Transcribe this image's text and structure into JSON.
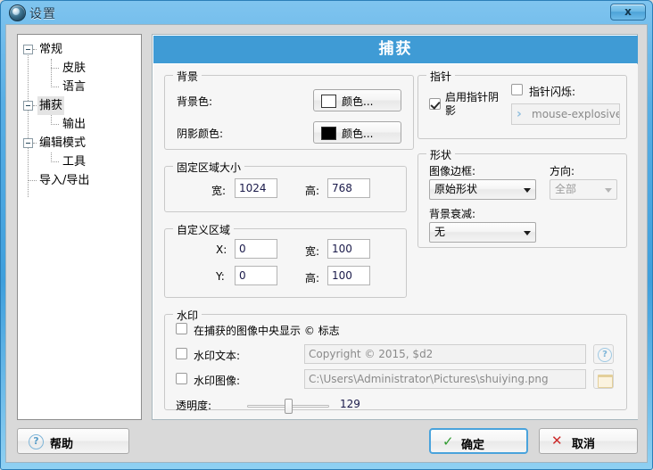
{
  "window": {
    "title": "设置",
    "icon": "app-camera-icon",
    "close_label": "x",
    "accent_color": "#3f9bd5",
    "frame_color": "#58aee4"
  },
  "sidebar": {
    "items": [
      {
        "label": "常规",
        "level": 0,
        "expandable": true,
        "selected": false
      },
      {
        "label": "皮肤",
        "level": 1,
        "expandable": false,
        "selected": false
      },
      {
        "label": "语言",
        "level": 1,
        "expandable": false,
        "selected": false
      },
      {
        "label": "捕获",
        "level": 0,
        "expandable": true,
        "selected": true
      },
      {
        "label": "输出",
        "level": 1,
        "expandable": false,
        "selected": false
      },
      {
        "label": "编辑模式",
        "level": 0,
        "expandable": true,
        "selected": false
      },
      {
        "label": "工具",
        "level": 1,
        "expandable": false,
        "selected": false
      },
      {
        "label": "导入/导出",
        "level": 0,
        "expandable": false,
        "selected": false
      }
    ]
  },
  "pane": {
    "header": "捕获",
    "background": {
      "title": "背景",
      "bg_color_label": "背景色:",
      "bg_color_button": "颜色...",
      "bg_color_swatch": "#ffffff",
      "shadow_color_label": "阴影颜色:",
      "shadow_color_button": "颜色...",
      "shadow_color_swatch": "#000000"
    },
    "fixed_area": {
      "title": "固定区域大小",
      "width_label": "宽:",
      "width_value": "1024",
      "height_label": "高:",
      "height_value": "768"
    },
    "custom_area": {
      "title": "自定义区域",
      "x_label": "X:",
      "x_value": "0",
      "y_label": "Y:",
      "y_value": "0",
      "width_label": "宽:",
      "width_value": "100",
      "height_label": "高:",
      "height_value": "100"
    },
    "pointer": {
      "title": "指针",
      "shadow_label": "启用指针阴影",
      "shadow_checked": true,
      "blink_label": "指针闪烁:",
      "blink_checked": false,
      "blink_file": "mouse-explosive.png",
      "blink_file_enabled": false
    },
    "shape": {
      "title": "形状",
      "border_label": "图像边框:",
      "border_value": "原始形状",
      "direction_label": "方向:",
      "direction_value": "全部",
      "direction_enabled": false,
      "fade_label": "背景衰减:",
      "fade_value": "无"
    },
    "watermark": {
      "title": "水印",
      "center_logo_label": "在捕获的图像中央显示 © 标志",
      "center_logo_checked": false,
      "text_label": "水印文本:",
      "text_checked": false,
      "text_value": "Copyright © 2015, $d2",
      "image_label": "水印图像:",
      "image_checked": false,
      "image_value": "C:\\Users\\Administrator\\Pictures\\shuiying.png",
      "opacity_label": "透明度:",
      "opacity_value": "129",
      "opacity_percent": 50
    }
  },
  "footer": {
    "help_label": "帮助",
    "ok_label": "确定",
    "cancel_label": "取消",
    "ok_glyph": "✓",
    "cancel_glyph": "✕",
    "help_glyph": "?"
  }
}
